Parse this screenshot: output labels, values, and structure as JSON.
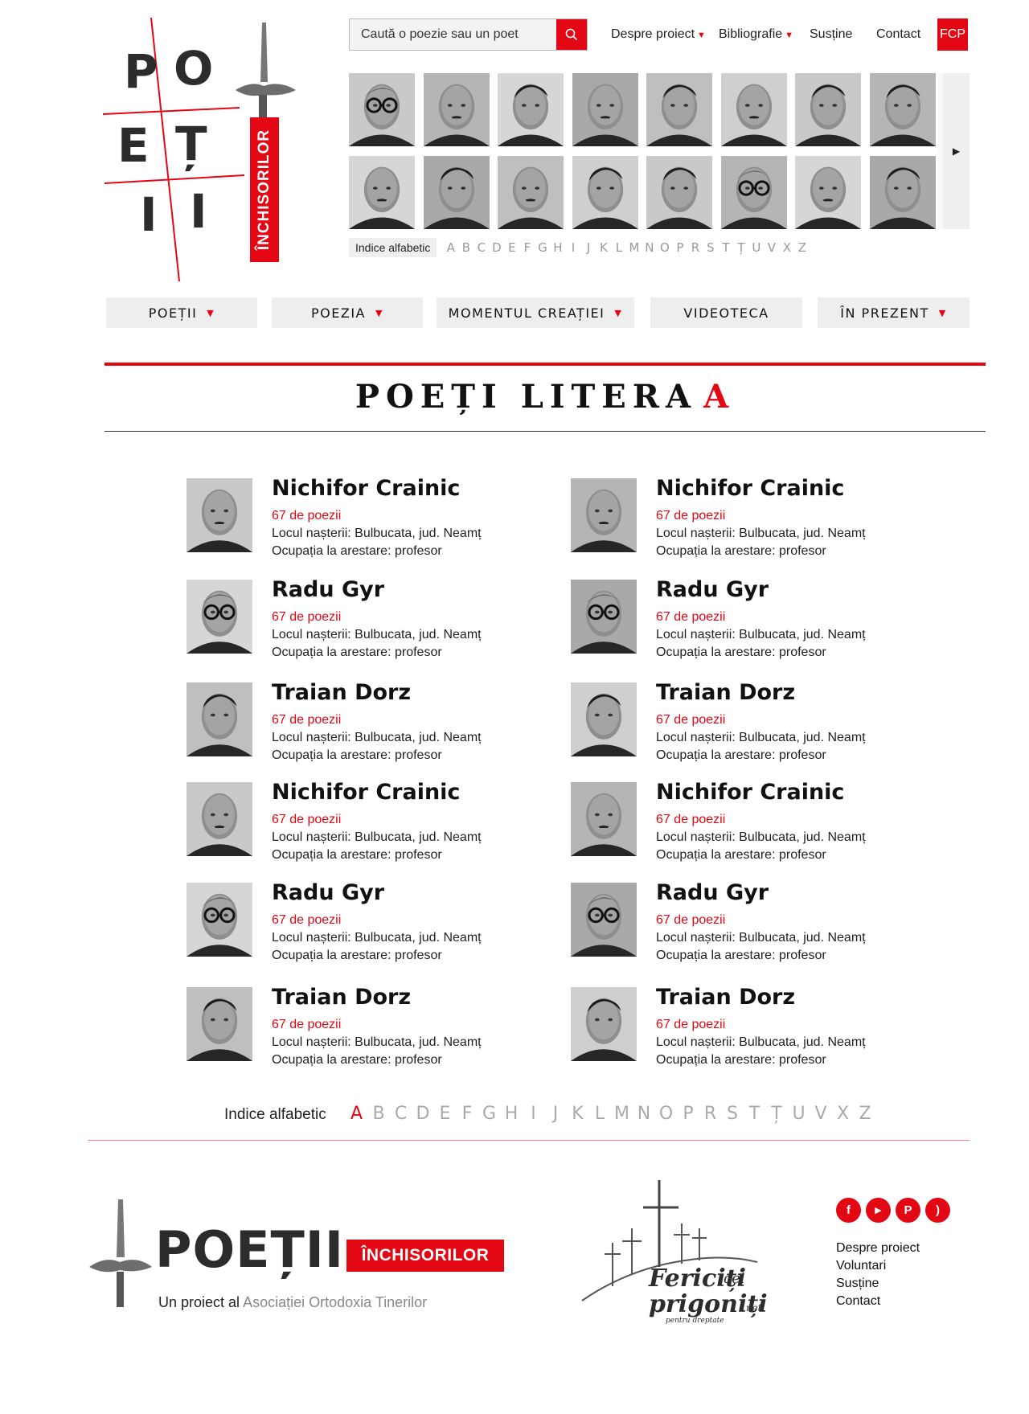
{
  "logo": {
    "letters": [
      "P",
      "O",
      "E",
      "Ț",
      "I",
      "I"
    ],
    "tag": "ÎNCHISORILOR"
  },
  "search": {
    "placeholder": "Caută o poezie sau un poet",
    "icon": "search-icon"
  },
  "topnav": {
    "items": [
      {
        "label": "Despre proiect",
        "dropdown": true
      },
      {
        "label": "Bibliografie",
        "dropdown": true
      },
      {
        "label": "Susține",
        "dropdown": false
      },
      {
        "label": "Contact",
        "dropdown": false
      }
    ],
    "badge": "FCP"
  },
  "portrait_strip": {
    "rows": 2,
    "per_row": 8,
    "next_icon": "▶"
  },
  "alpha_index_small": {
    "label": "Indice alfabetic",
    "letters": [
      "A",
      "B",
      "C",
      "D",
      "E",
      "F",
      "G",
      "H",
      "I",
      "J",
      "K",
      "L",
      "M",
      "N",
      "O",
      "P",
      "R",
      "S",
      "T",
      "Ț",
      "U",
      "V",
      "X",
      "Z"
    ]
  },
  "main_menu": [
    {
      "label": "POEȚII",
      "dropdown": true
    },
    {
      "label": "POEZIA",
      "dropdown": true
    },
    {
      "label": "MOMENTUL CREAȚIEI",
      "dropdown": true
    },
    {
      "label": "VIDEOTECA",
      "dropdown": false
    },
    {
      "label": "ÎN PREZENT",
      "dropdown": true
    }
  ],
  "page_title": {
    "text": "POEȚI LITERA",
    "letter": "A"
  },
  "poets": [
    {
      "name": "Nichifor Crainic",
      "count": "67 de poezii",
      "birth": "Locul nașterii: Bulbucata, jud. Neamț",
      "occupation": "Ocupația la arestare: profesor",
      "photo": "bald"
    },
    {
      "name": "Nichifor Crainic",
      "count": "67 de poezii",
      "birth": "Locul nașterii: Bulbucata, jud. Neamț",
      "occupation": "Ocupația la arestare: profesor",
      "photo": "bald"
    },
    {
      "name": "Radu Gyr",
      "count": "67 de poezii",
      "birth": "Locul nașterii: Bulbucata, jud. Neamț",
      "occupation": "Ocupația la arestare: profesor",
      "photo": "glasses"
    },
    {
      "name": "Radu Gyr",
      "count": "67 de poezii",
      "birth": "Locul nașterii: Bulbucata, jud. Neamț",
      "occupation": "Ocupația la arestare: profesor",
      "photo": "glasses"
    },
    {
      "name": "Traian Dorz",
      "count": "67 de poezii",
      "birth": "Locul nașterii: Bulbucata, jud. Neamț",
      "occupation": "Ocupația la arestare: profesor",
      "photo": "hair"
    },
    {
      "name": "Traian Dorz",
      "count": "67 de poezii",
      "birth": "Locul nașterii: Bulbucata, jud. Neamț",
      "occupation": "Ocupația la arestare: profesor",
      "photo": "hair"
    },
    {
      "name": "Nichifor Crainic",
      "count": "67 de poezii",
      "birth": "Locul nașterii: Bulbucata, jud. Neamț",
      "occupation": "Ocupația la arestare: profesor",
      "photo": "bald"
    },
    {
      "name": "Nichifor Crainic",
      "count": "67 de poezii",
      "birth": "Locul nașterii: Bulbucata, jud. Neamț",
      "occupation": "Ocupația la arestare: profesor",
      "photo": "bald"
    },
    {
      "name": "Radu Gyr",
      "count": "67 de poezii",
      "birth": "Locul nașterii: Bulbucata, jud. Neamț",
      "occupation": "Ocupația la arestare: profesor",
      "photo": "glasses"
    },
    {
      "name": "Radu Gyr",
      "count": "67 de poezii",
      "birth": "Locul nașterii: Bulbucata, jud. Neamț",
      "occupation": "Ocupația la arestare: profesor",
      "photo": "glasses"
    },
    {
      "name": "Traian Dorz",
      "count": "67 de poezii",
      "birth": "Locul nașterii: Bulbucata, jud. Neamț",
      "occupation": "Ocupația la arestare: profesor",
      "photo": "hair"
    },
    {
      "name": "Traian Dorz",
      "count": "67 de poezii",
      "birth": "Locul nașterii: Bulbucata, jud. Neamț",
      "occupation": "Ocupația la arestare: profesor",
      "photo": "hair"
    }
  ],
  "alpha_index_big": {
    "label": "Indice alfabetic",
    "active": "A",
    "letters": [
      "A",
      "B",
      "C",
      "D",
      "E",
      "F",
      "G",
      "H",
      "I",
      "J",
      "K",
      "L",
      "M",
      "N",
      "O",
      "P",
      "R",
      "S",
      "T",
      "Ț",
      "U",
      "V",
      "X",
      "Z"
    ]
  },
  "footer": {
    "logo_word": "POEȚII",
    "logo_tag": "ÎNCHISORILOR",
    "subtitle_prefix": "Un proiect al",
    "subtitle_link": "Asociației Ortodoxia Tinerilor",
    "partner": {
      "line1": "Fericiți",
      "line1_small": "cei",
      "line2": "prigoniți",
      "line2_small": ".net",
      "tagline": "pentru dreptate"
    },
    "social": [
      {
        "icon": "facebook-icon",
        "glyph": "f"
      },
      {
        "icon": "youtube-icon",
        "glyph": "▶"
      },
      {
        "icon": "paypal-icon",
        "glyph": "P"
      },
      {
        "icon": "rss-icon",
        "glyph": ")"
      }
    ],
    "links": [
      "Despre proiect",
      "Voluntari",
      "Susține",
      "Contact"
    ]
  },
  "colors": {
    "accent": "#e30613",
    "menu_bg": "#eeeeee",
    "text": "#111111"
  }
}
